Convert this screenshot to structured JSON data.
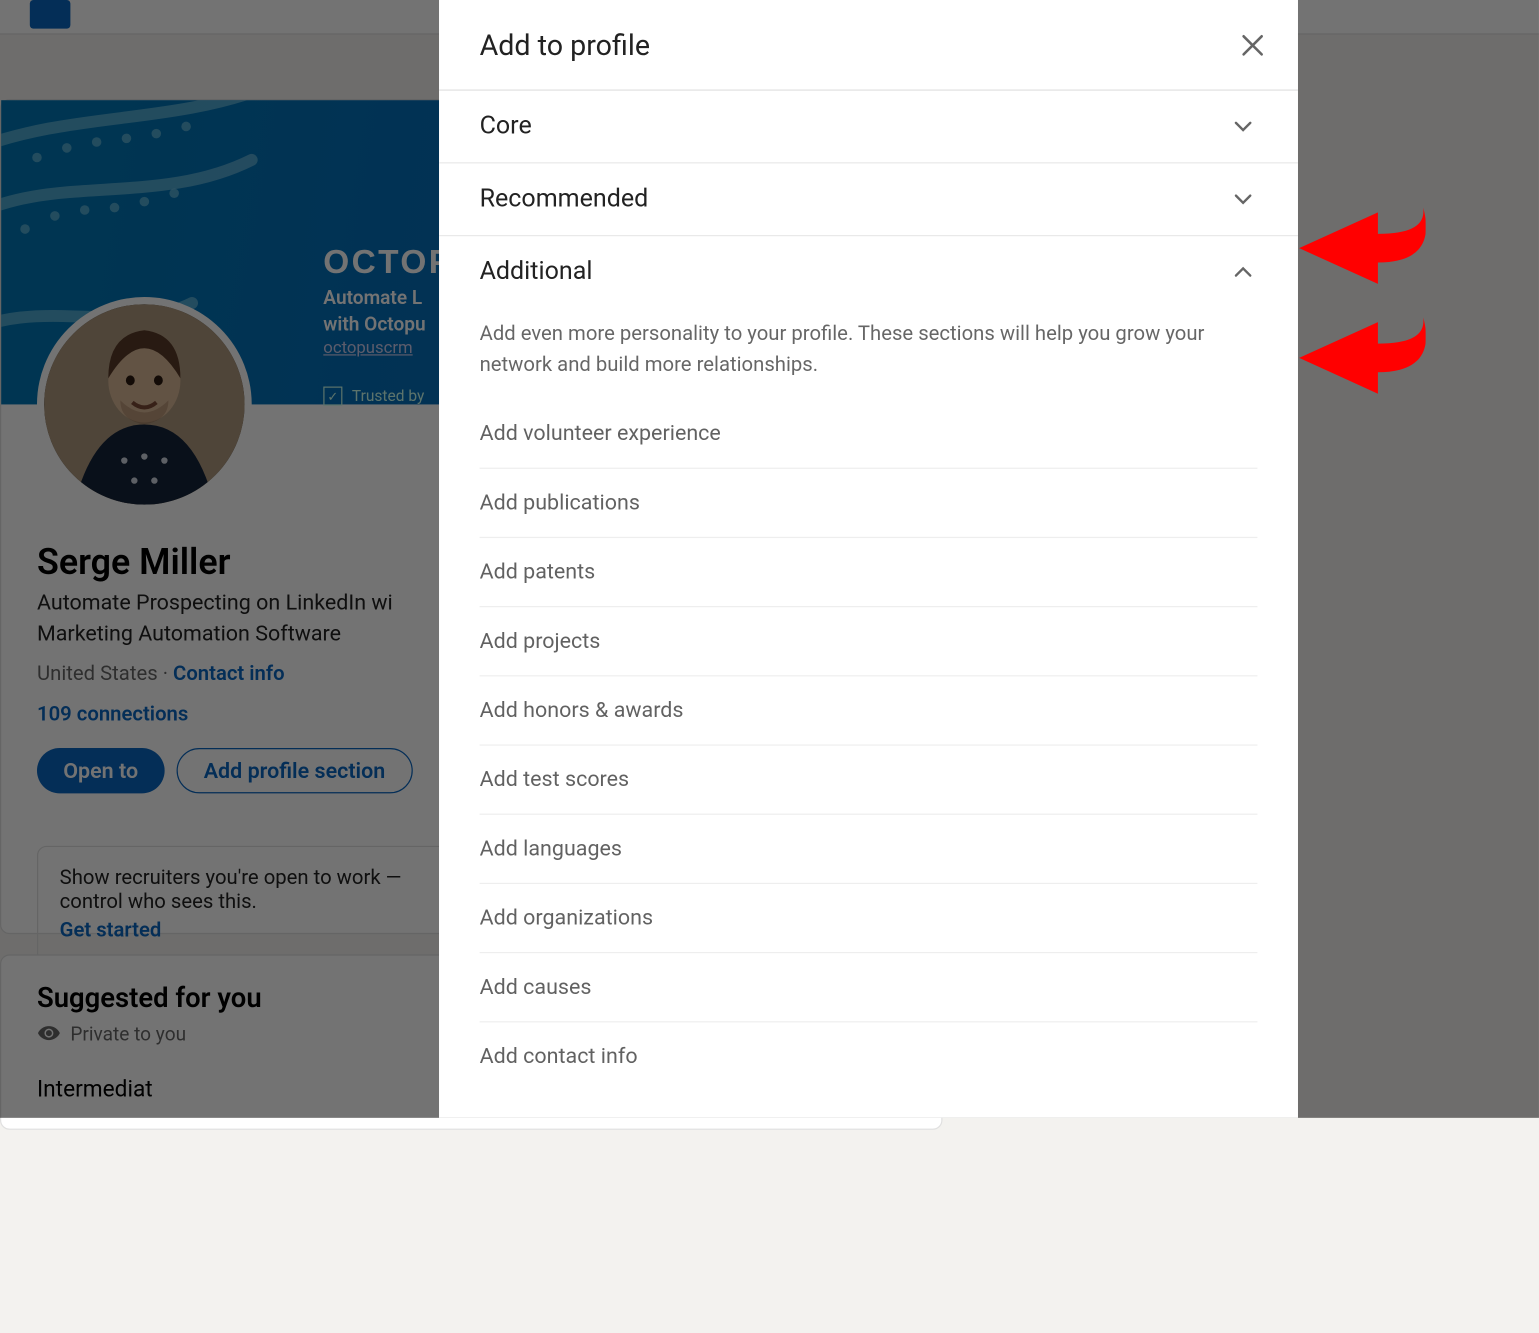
{
  "banner": {
    "brand": "OCTOPU",
    "tag1": "Automate L",
    "tag2": "with Octopu",
    "link": "octopuscrm",
    "trusted": "Trusted by"
  },
  "profile": {
    "name": "Serge Miller",
    "headline1": "Automate Prospecting on LinkedIn wi",
    "headline2": "Marketing Automation Software",
    "location": "United States",
    "contact": "Contact info",
    "connections": "109 connections",
    "open_to": "Open to",
    "add_section": "Add profile section"
  },
  "tip": {
    "line1": "Show recruiters you're open to work —",
    "line2": "control who sees this.",
    "cta": "Get started"
  },
  "suggested": {
    "title": "Suggested for you",
    "privacy": "Private to you",
    "intermediate": "Intermediat"
  },
  "modal": {
    "title": "Add to profile",
    "sections": {
      "core": "Core",
      "recommended": "Recommended",
      "additional": "Additional"
    },
    "additional_desc": "Add even more personality to your profile. These sections will help you grow your network and build more relationships.",
    "items": [
      "Add volunteer experience",
      "Add publications",
      "Add patents",
      "Add projects",
      "Add honors & awards",
      "Add test scores",
      "Add languages",
      "Add organizations",
      "Add causes",
      "Add contact info"
    ]
  }
}
